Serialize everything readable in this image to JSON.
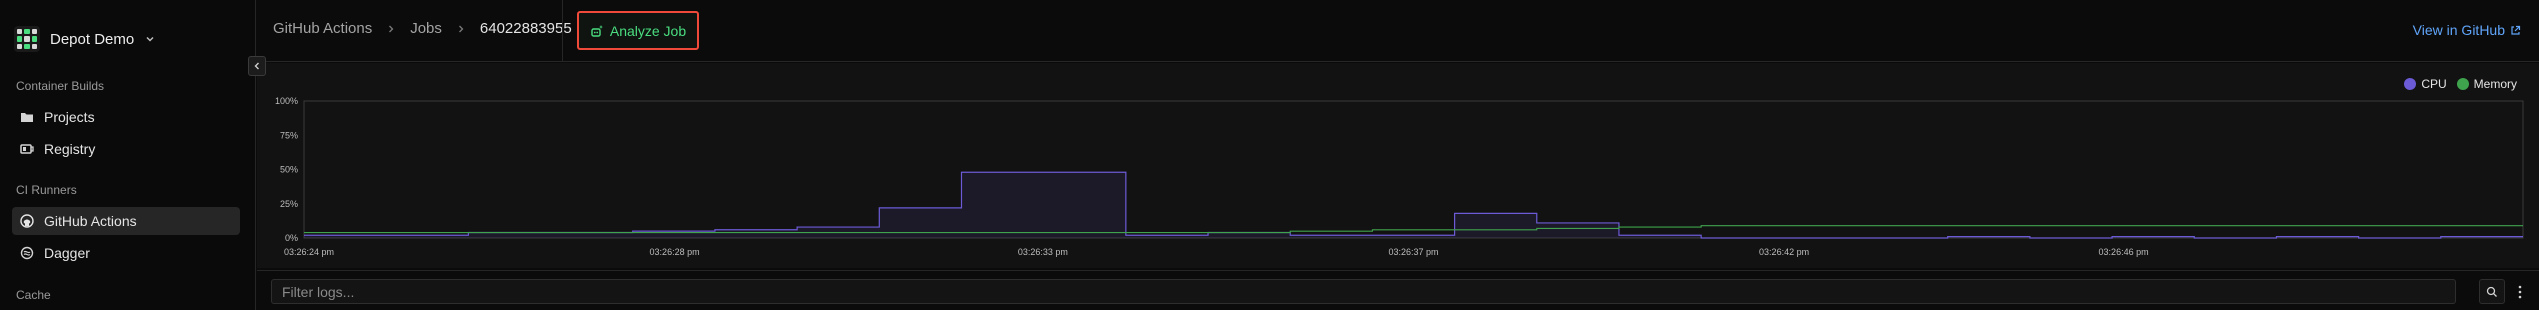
{
  "org": {
    "name": "Depot Demo"
  },
  "sidebar": {
    "sections": [
      {
        "title": "Container Builds"
      },
      {
        "title": "CI Runners"
      },
      {
        "title": "Cache"
      }
    ],
    "items": [
      {
        "label": "Projects",
        "icon": "folder-icon"
      },
      {
        "label": "Registry",
        "icon": "registry-icon"
      },
      {
        "label": "GitHub Actions",
        "icon": "github-icon",
        "active": true
      },
      {
        "label": "Dagger",
        "icon": "dagger-icon"
      }
    ]
  },
  "header": {
    "breadcrumb": [
      "GitHub Actions",
      "Jobs",
      "64022883955"
    ],
    "analyze_label": "Analyze Job",
    "github_link_label": "View in GitHub"
  },
  "colors": {
    "cpu": "#6b5bd6",
    "memory": "#3fa34d",
    "accent_green": "#4ade80",
    "link_blue": "#60a5fa",
    "highlight_red": "#f04a3a"
  },
  "chart_data": {
    "type": "area",
    "step": true,
    "legend": [
      "CPU",
      "Memory"
    ],
    "legend_position": "top-right",
    "yticks": [
      "100%",
      "75%",
      "50%",
      "25%",
      "0%"
    ],
    "ylim": [
      0,
      100
    ],
    "xticks": [
      "03:26:24 pm",
      "03:26:28 pm",
      "03:26:33 pm",
      "03:26:37 pm",
      "03:26:42 pm",
      "03:26:46 pm"
    ],
    "x_segments": 27,
    "series": [
      {
        "name": "CPU",
        "values": [
          2,
          2,
          4,
          4,
          5,
          6,
          8,
          22,
          48,
          48,
          2,
          4,
          2,
          2,
          18,
          11,
          2,
          0,
          0,
          0,
          1,
          0,
          1,
          0,
          1,
          0,
          1
        ]
      },
      {
        "name": "Memory",
        "values": [
          4,
          4,
          4,
          4,
          4,
          4,
          4,
          4,
          4,
          4,
          4,
          4,
          5,
          6,
          6,
          7,
          8,
          9,
          9,
          9,
          9,
          9,
          9,
          9,
          9,
          9,
          9
        ]
      }
    ]
  },
  "logs": {
    "filter_placeholder": "Filter logs..."
  }
}
